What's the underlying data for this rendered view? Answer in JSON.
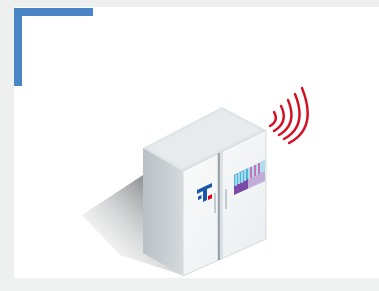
{
  "illustration": {
    "subject": "smart-cabinet-with-wireless-signal",
    "icons": [
      "telekom-logo-icon",
      "wireless-signal-icon",
      "barcode-label-icon"
    ]
  },
  "colors": {
    "accent_bar": "#4a86c6",
    "signal_waves": "#d40f23",
    "logo_blue": "#1b57a8",
    "logo_red": "#e2001a",
    "cabinet_face": "#f4f6f7",
    "cabinet_side": "#c9d0d4",
    "cabinet_top": "#e2e6e8",
    "background": "#ffffff"
  }
}
